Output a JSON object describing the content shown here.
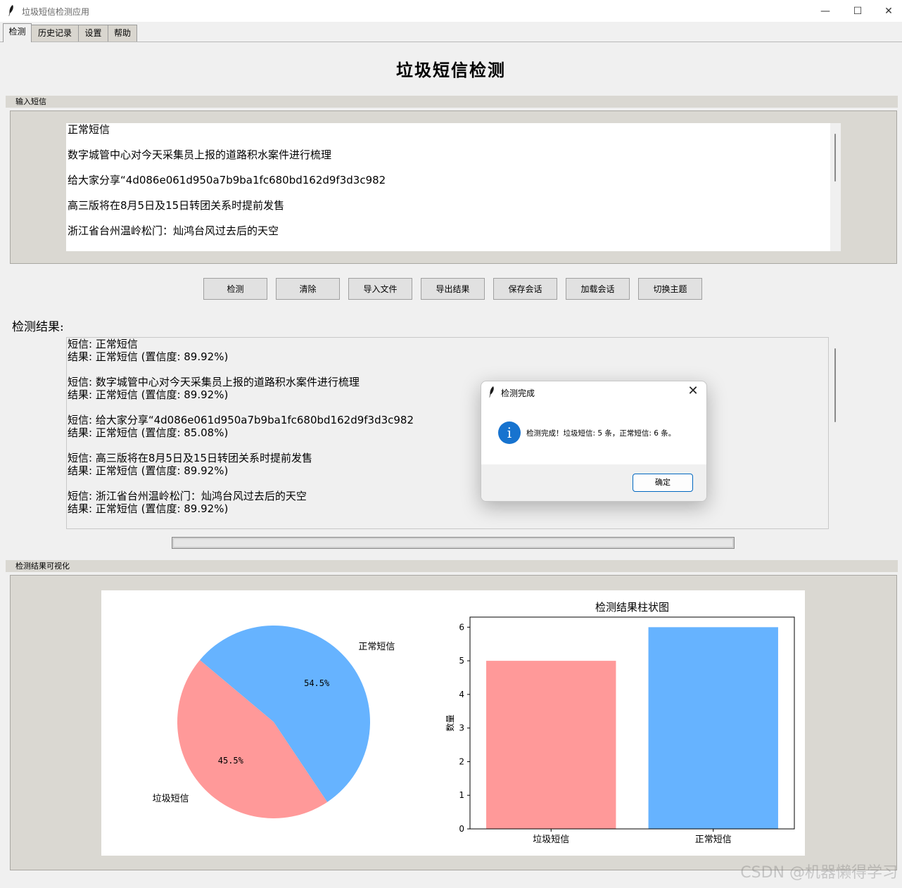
{
  "window": {
    "title": "垃圾短信检测应用",
    "min": "—",
    "max": "☐",
    "close": "✕"
  },
  "tabs": [
    {
      "label": "检测",
      "active": true
    },
    {
      "label": "历史记录",
      "active": false
    },
    {
      "label": "设置",
      "active": false
    },
    {
      "label": "帮助",
      "active": false
    }
  ],
  "heading": "垃圾短信检测",
  "input_frame": {
    "label": "输入短信",
    "lines": [
      "正常短信",
      "数字城管中心对今天采集员上报的道路积水案件进行梳理",
      "给大家分享“4d086e061d950a7b9ba1fc680bd162d9f3d3c982",
      "高三版将在8月5日及15日转团关系时提前发售",
      "浙江省台州温岭松门：灿鸿台风过去后的天空"
    ]
  },
  "buttons": [
    "检测",
    "清除",
    "导入文件",
    "导出结果",
    "保存会话",
    "加载会话",
    "切换主题"
  ],
  "results": {
    "label": "检测结果:",
    "items": [
      {
        "sms": "短信: 正常短信",
        "result": "结果: 正常短信 (置信度: 89.92%)"
      },
      {
        "sms": "短信: 数字城管中心对今天采集员上报的道路积水案件进行梳理",
        "result": "结果: 正常短信 (置信度: 89.92%)"
      },
      {
        "sms": "短信: 给大家分享“4d086e061d950a7b9ba1fc680bd162d9f3d3c982",
        "result": "结果: 正常短信 (置信度: 85.08%)"
      },
      {
        "sms": "短信: 高三版将在8月5日及15日转团关系时提前发售",
        "result": "结果: 正常短信 (置信度: 89.92%)"
      },
      {
        "sms": "短信: 浙江省台州温岭松门：灿鸿台风过去后的天空",
        "result": "结果: 正常短信 (置信度: 89.92%)"
      }
    ]
  },
  "progress": {
    "value": 0
  },
  "visual_frame": {
    "label": "检测结果可视化"
  },
  "chart_data": [
    {
      "type": "pie",
      "slices": [
        {
          "label": "垃圾短信",
          "value": 45.5,
          "pct_text": "45.5%",
          "color": "#ff9999"
        },
        {
          "label": "正常短信",
          "value": 54.5,
          "pct_text": "54.5%",
          "color": "#66b3ff"
        }
      ]
    },
    {
      "type": "bar",
      "title": "检测结果柱状图",
      "categories": [
        "垃圾短信",
        "正常短信"
      ],
      "values": [
        5,
        6
      ],
      "colors": [
        "#ff9999",
        "#66b3ff"
      ],
      "ylabel": "数量",
      "ylim": [
        0,
        6.3
      ],
      "yticks": [
        "0",
        "1",
        "2",
        "3",
        "4",
        "5",
        "6"
      ]
    }
  ],
  "dialog": {
    "title": "检测完成",
    "icon": "info-icon",
    "icon_glyph": "i",
    "message": "检测完成！垃圾短信: 5 条，正常短信: 6 条。",
    "ok_label": "确定",
    "close_glyph": "✕"
  },
  "watermark": "CSDN @机器懒得学习"
}
